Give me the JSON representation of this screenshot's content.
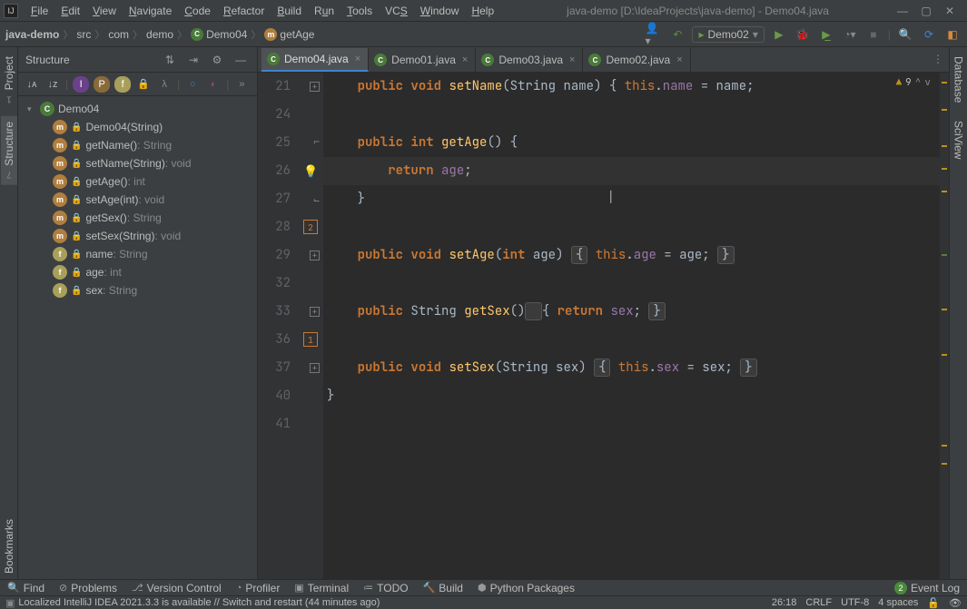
{
  "title_bar": {
    "project_path": "java-demo [D:\\IdeaProjects\\java-demo] - Demo04.java"
  },
  "menu": {
    "file": "File",
    "edit": "Edit",
    "view": "View",
    "navigate": "Navigate",
    "code": "Code",
    "refactor": "Refactor",
    "build": "Build",
    "run": "Run",
    "tools": "Tools",
    "vcs": "VCS",
    "window": "Window",
    "help": "Help"
  },
  "breadcrumbs": {
    "items": [
      "java-demo",
      "src",
      "com",
      "demo",
      "Demo04",
      "getAge"
    ]
  },
  "run_config": {
    "selected": "Demo02"
  },
  "structure_panel": {
    "title": "Structure",
    "root": {
      "name": "Demo04"
    },
    "members": [
      {
        "kind": "m",
        "name": "Demo04(String)",
        "ret": ""
      },
      {
        "kind": "m",
        "name": "getName()",
        "ret": ": String"
      },
      {
        "kind": "m",
        "name": "setName(String)",
        "ret": ": void"
      },
      {
        "kind": "m",
        "name": "getAge()",
        "ret": ": int"
      },
      {
        "kind": "m",
        "name": "setAge(int)",
        "ret": ": void"
      },
      {
        "kind": "m",
        "name": "getSex()",
        "ret": ": String"
      },
      {
        "kind": "m",
        "name": "setSex(String)",
        "ret": ": void"
      },
      {
        "kind": "f",
        "name": "name",
        "ret": ": String"
      },
      {
        "kind": "f",
        "name": "age",
        "ret": ": int"
      },
      {
        "kind": "f",
        "name": "sex",
        "ret": ": String"
      }
    ]
  },
  "tabs": [
    {
      "label": "Demo04.java",
      "active": true
    },
    {
      "label": "Demo01.java",
      "active": false
    },
    {
      "label": "Demo03.java",
      "active": false
    },
    {
      "label": "Demo02.java",
      "active": false
    }
  ],
  "editor": {
    "line_numbers": [
      "21",
      "24",
      "25",
      "26",
      "27",
      "28",
      "29",
      "32",
      "33",
      "36",
      "37",
      "40",
      "41"
    ],
    "problems": {
      "warnings": 9
    },
    "folds": {
      "box_28": "2",
      "box_36": "1"
    }
  },
  "left_rail": {
    "project": "Project",
    "structure": "Structure",
    "bookmarks": "Bookmarks",
    "project_num": "1",
    "structure_num": "7"
  },
  "right_rail": {
    "database": "Database",
    "sciview": "SciView"
  },
  "bottom_tools": {
    "find": "Find",
    "problems": "Problems",
    "vcs": "Version Control",
    "profiler": "Profiler",
    "terminal": "Terminal",
    "todo": "TODO",
    "build": "Build",
    "python": "Python Packages",
    "event_log": "Event Log",
    "event_count": "2"
  },
  "status_bar": {
    "message": "Localized IntelliJ IDEA 2021.3.3 is available // Switch and restart (44 minutes ago)",
    "pos": "26:18",
    "line_sep": "CRLF",
    "encoding": "UTF-8",
    "indent": "4 spaces"
  }
}
